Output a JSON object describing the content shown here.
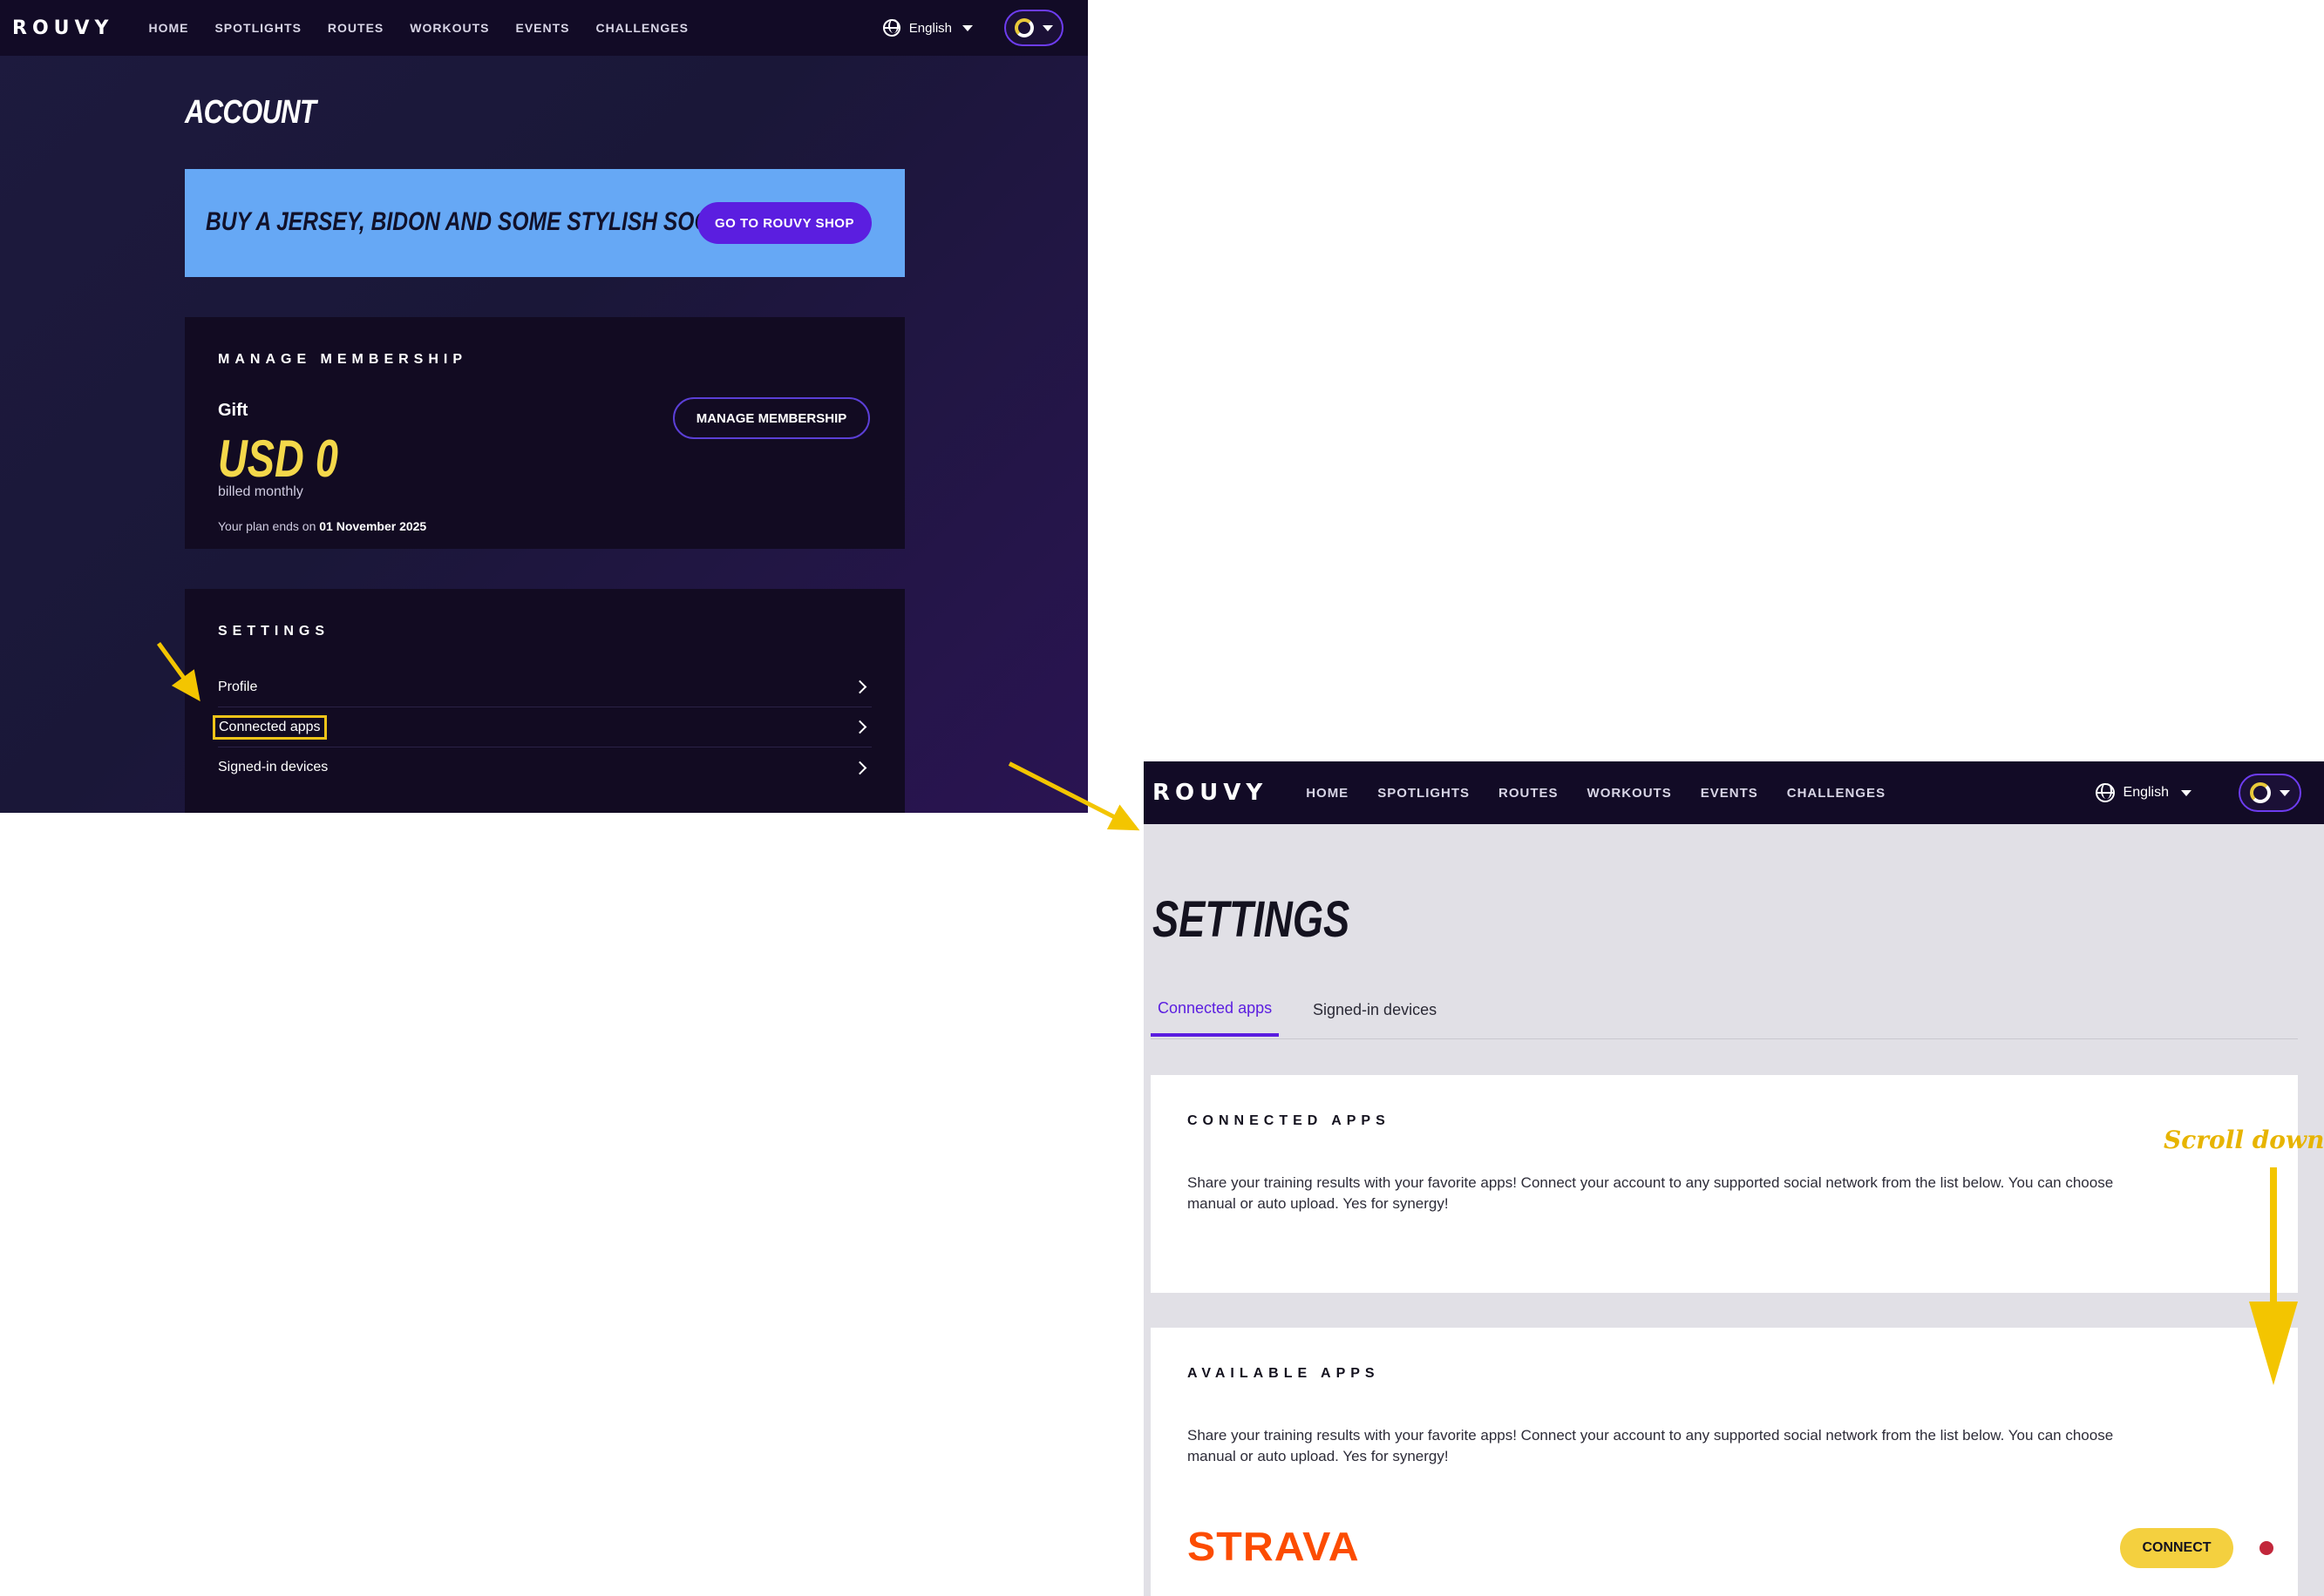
{
  "nav": {
    "logo": "ROUVY",
    "links": [
      "HOME",
      "SPOTLIGHTS",
      "ROUTES",
      "WORKOUTS",
      "EVENTS",
      "CHALLENGES"
    ],
    "language": "English"
  },
  "account": {
    "title": "ACCOUNT",
    "banner": {
      "text": "BUY A JERSEY, BIDON AND SOME STYLISH SOCKS",
      "button": "GO TO ROUVY SHOP"
    },
    "membership": {
      "heading": "MANAGE MEMBERSHIP",
      "plan": "Gift",
      "price": "USD 0",
      "billing": "billed monthly",
      "ends_prefix": "Your plan ends on",
      "ends_date": "01 November 2025",
      "button": "MANAGE MEMBERSHIP"
    },
    "settings": {
      "heading": "SETTINGS",
      "items": [
        "Profile",
        "Connected apps",
        "Signed-in devices"
      ]
    }
  },
  "settings_page": {
    "title": "SETTINGS",
    "tabs": [
      "Connected apps",
      "Signed-in devices"
    ],
    "connected": {
      "heading": "CONNECTED APPS",
      "desc_line1": "Share your training results with your favorite apps! Connect your account to any supported social network from the list below. You can choose",
      "desc_line2": "manual or auto upload. Yes for synergy!"
    },
    "available": {
      "heading": "AVAILABLE APPS",
      "desc_line1": "Share your training results with your favorite apps! Connect your account to any supported social network from the list below. You can choose",
      "desc_line2": "manual or auto upload. Yes for synergy!",
      "app_name": "STRAVA",
      "connect_button": "CONNECT"
    }
  },
  "annotation": {
    "scroll_note": "Scroll down"
  },
  "colors": {
    "nav_bg": "#120b26",
    "accent_purple": "#5b1ee0",
    "banner_blue": "#66a8f5",
    "price_yellow": "#f4d84a",
    "strava_orange": "#fc4c02",
    "connect_yellow": "#f4d03f",
    "highlight_yellow": "#f3c500",
    "status_red": "#c2273b"
  }
}
